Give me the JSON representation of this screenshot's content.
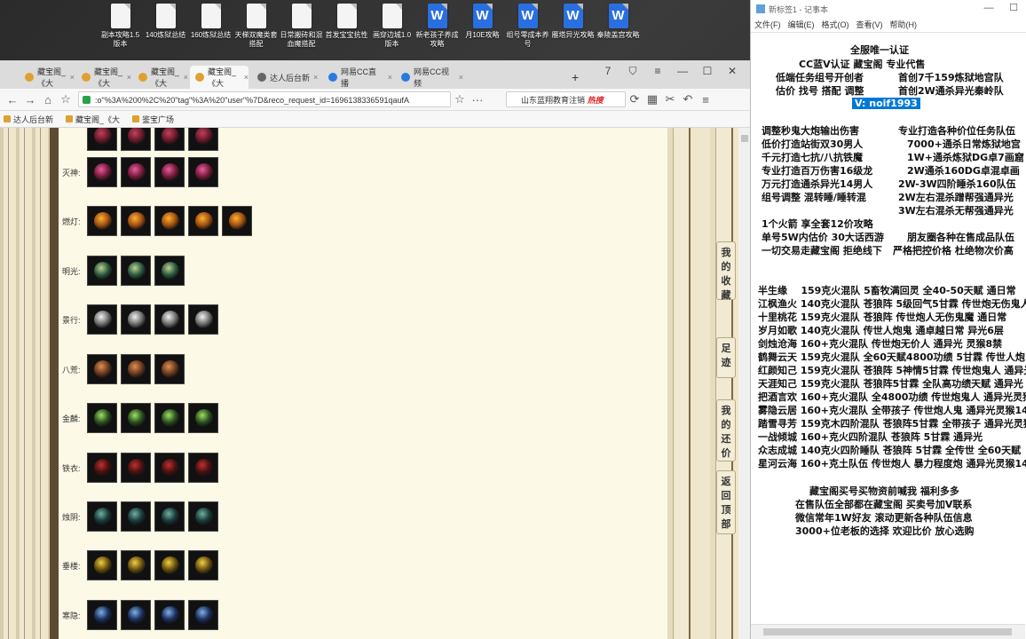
{
  "desktop": {
    "icons": [
      {
        "label": "副本攻略1.5版本",
        "type": "doc"
      },
      {
        "label": "140炼狱总结",
        "type": "doc"
      },
      {
        "label": "160炼狱总结",
        "type": "doc"
      },
      {
        "label": "天梯双魔类套搭配",
        "type": "doc"
      },
      {
        "label": "日常搬砖和混血魔搭配",
        "type": "doc"
      },
      {
        "label": "首发宝宝抗性",
        "type": "doc"
      },
      {
        "label": "画穿边城1.0版本",
        "type": "doc"
      },
      {
        "label": "新老孩子养成攻略",
        "type": "wps"
      },
      {
        "label": "月10E攻略",
        "type": "wps"
      },
      {
        "label": "组号零成本养号",
        "type": "wps"
      },
      {
        "label": "雁塔异光攻略",
        "type": "wps"
      },
      {
        "label": "秦陵盖宫攻略",
        "type": "wps"
      }
    ]
  },
  "browser": {
    "tabs": [
      {
        "label": "藏宝阁_《大",
        "fav_color": "#e0a030"
      },
      {
        "label": "藏宝阁_《大",
        "fav_color": "#e0a030"
      },
      {
        "label": "藏宝阁_《大",
        "fav_color": "#e0a030"
      },
      {
        "label": "藏宝阁_《大",
        "fav_color": "#e0a030"
      },
      {
        "label": "达人后台新",
        "fav_color": "#666666"
      },
      {
        "label": "网易CC直播",
        "fav_color": "#2a7ae2"
      },
      {
        "label": "网易CC视频",
        "fav_color": "#2a7ae2"
      }
    ],
    "active_tab": 3,
    "tab_count_badge": "7",
    "url": ":o\"%3A%200%2C%20\"tag\"%3A%20\"user\"%7D&reco_request_id=1696138336591qaufA",
    "search_text": "山东蓝翔教育注销",
    "search_hot": "热搜",
    "bookmarks": [
      "达人后台新",
      "藏宝阁_《大",
      "鉴宝广场"
    ]
  },
  "page": {
    "rows": [
      {
        "label": "",
        "count": 4,
        "c1": "#6a1a2a",
        "c2": "#c04060"
      },
      {
        "label": "灭神:",
        "count": 4,
        "c1": "#7a1a3a",
        "c2": "#e060a0"
      },
      {
        "label": "燃灯:",
        "count": 5,
        "c1": "#a05010",
        "c2": "#ffb030"
      },
      {
        "label": "明光:",
        "count": 3,
        "c1": "#2a5a40",
        "c2": "#c0d090"
      },
      {
        "label": "景行:",
        "count": 4,
        "c1": "#707070",
        "c2": "#f0f0f0"
      },
      {
        "label": "八荒:",
        "count": 3,
        "c1": "#6a3a20",
        "c2": "#e09050"
      },
      {
        "label": "金麟:",
        "count": 4,
        "c1": "#2a5020",
        "c2": "#a0e060"
      },
      {
        "label": "铁衣:",
        "count": 4,
        "c1": "#4a1010",
        "c2": "#c03030"
      },
      {
        "label": "烛阴:",
        "count": 4,
        "c1": "#1a3a3a",
        "c2": "#70b0a0"
      },
      {
        "label": "垂楼:",
        "count": 4,
        "c1": "#6a5010",
        "c2": "#f0d040"
      },
      {
        "label": "寒隐:",
        "count": 4,
        "c1": "#1a3060",
        "c2": "#80b0e0"
      }
    ],
    "side_nav": [
      "我的收藏",
      "足迹",
      "我的还价",
      "返回顶部"
    ]
  },
  "notepad": {
    "title": "新标签1 - 记事本",
    "menu": [
      "文件(F)",
      "编辑(E)",
      "格式(O)",
      "查看(V)",
      "帮助(H)"
    ],
    "selected_line": "V: noif1993",
    "lines": [
      "全服唯一认证",
      "CC蓝V认证 藏宝阁 专业代售",
      "低端任务组号开创者",
      "首创7千159炼狱地宫队",
      "估价 找号 搭配 调整",
      "首创2W通杀异光秦岭队",
      "调整秒鬼大炮输出伤害",
      "专业打造各种价位任务队伍",
      "低价打造站街双30男人",
      "7000+通杀日常炼狱地宫",
      "千元打造七抗/八抗铁魔",
      "1W+通杀炼狱DG卓7画窟",
      "专业打造百万伤害16级龙",
      "2W通杀160DG卓混卓画",
      "万元打造通杀异光14男人",
      "2W-3W四阶睡杀160队伍",
      "组号调整 混转睡/睡转混",
      "2W左右混杀蹭帮强通异光",
      "3W左右混杀无帮强通异光",
      "1个火箭 享全套12价攻略",
      "单号5W内估价 30大话西游",
      "朋友圈各种在售成品队伍",
      "一切交易走藏宝阁 拒绝线下",
      "严格把控价格 杜绝物次价高",
      "半生缘    159克火混队 5畜牧满回灵 全40-50天赋 通日常",
      "江枫渔火 140克火混队 苍狼阵 5级回气5甘霖 传世炮无伤鬼人",
      "十里桃花 159克火混队 苍狼阵 传世炮人无伤鬼魔 通日常",
      "岁月如歌 140克火混队 传世人炮鬼 通卓越日常 异光6层",
      "剑烛沧海 160+克火混队 传世炮无价人 通异光 灵猴8禁",
      "鹤舞云天 159克火混队 全60天赋4800功绩 5甘霖 传世人炮",
      "红颜知己 159克火混队 苍狼阵 5神情5甘霖 传世炮鬼人 通异光",
      "天涯知己 159克火混队 苍狼阵5甘霖 全队高功绩天赋 通异光",
      "把酒言欢 160+克火混队 全4800功绩 传世炮鬼人 通异光灵猴",
      "雾隐云居 160+克火混队 全带孩子 传世炮人鬼 通异光灵猴14",
      "踏雪寻芳 159克木四阶混队 苍狼阵5甘霖 全带孩子 通异光灵猴",
      "一战倾城 160+克火四阶混队 苍狼阵 5甘霖 通异光",
      "众志成城 140克火四阶睡队 苍狼阵 5甘霖 全传世 全60天赋",
      "星河云海 160+克土队伍 传世炮人 暴力程度炮 通异光灵猴14",
      "藏宝阁买号买物资前喊我 福利多多",
      "在售队伍全部都在藏宝阁 买卖号加V联系",
      "微信常年1W好友 滚动更新各种队伍信息",
      "3000+位老板的选择 欢迎比价 放心选购"
    ]
  }
}
